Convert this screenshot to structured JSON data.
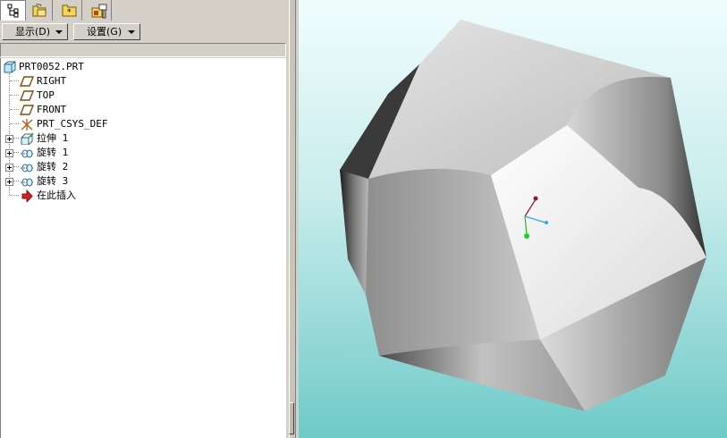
{
  "toolbar": {
    "tabs": [
      {
        "icon": "model-tree-icon",
        "active": true
      },
      {
        "icon": "folder-browser-icon",
        "active": false
      },
      {
        "icon": "favorites-folder-icon",
        "active": false
      },
      {
        "icon": "connections-icon",
        "active": false
      }
    ]
  },
  "menu": {
    "display_label": "显示(D)",
    "settings_label": "设置(G)"
  },
  "tree": {
    "root": {
      "label": "PRT0052.PRT",
      "icon": "part-icon"
    },
    "items": [
      {
        "label": "RIGHT",
        "icon": "datum-plane-icon",
        "expandable": false
      },
      {
        "label": "TOP",
        "icon": "datum-plane-icon",
        "expandable": false
      },
      {
        "label": "FRONT",
        "icon": "datum-plane-icon",
        "expandable": false
      },
      {
        "label": "PRT_CSYS_DEF",
        "icon": "coordinate-system-icon",
        "expandable": false
      },
      {
        "label": "拉伸 1",
        "icon": "extrude-icon",
        "expandable": true
      },
      {
        "label": "旋转 1",
        "icon": "revolve-icon",
        "expandable": true
      },
      {
        "label": "旋转 2",
        "icon": "revolve-icon",
        "expandable": true
      },
      {
        "label": "旋转 3",
        "icon": "revolve-icon",
        "expandable": true
      },
      {
        "label": "在此插入",
        "icon": "insert-here-arrow-icon",
        "expandable": false
      }
    ]
  },
  "viewport": {
    "background_top": "#f0fdfd",
    "background_bottom": "#6fcac8",
    "model_color": "#c9c9c9"
  }
}
